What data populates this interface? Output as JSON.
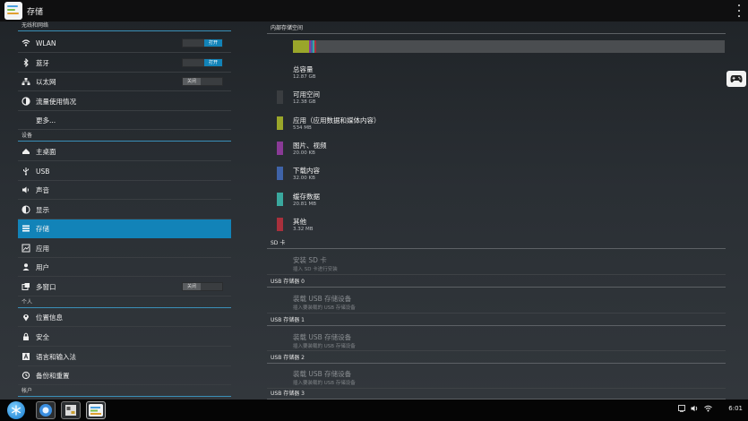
{
  "window": {
    "title": "存储"
  },
  "left": {
    "sections": [
      {
        "header": "无线和网络",
        "rows": [
          {
            "label": "WLAN",
            "icon": "wifi-icon",
            "toggle": "打开",
            "toggle_state": "on"
          },
          {
            "label": "蓝牙",
            "icon": "bluetooth-icon",
            "toggle": "打开",
            "toggle_state": "on"
          },
          {
            "label": "以太网",
            "icon": "ethernet-icon",
            "toggle": "关闭",
            "toggle_state": "off"
          },
          {
            "label": "流量使用情况",
            "icon": "data-usage-icon"
          },
          {
            "label": "更多...",
            "icon": ""
          }
        ]
      },
      {
        "header": "设备",
        "rows": [
          {
            "label": "主桌面",
            "icon": "home-icon"
          },
          {
            "label": "USB",
            "icon": "usb-icon"
          },
          {
            "label": "声音",
            "icon": "volume-icon"
          },
          {
            "label": "显示",
            "icon": "display-icon"
          },
          {
            "label": "存储",
            "icon": "storage-icon",
            "selected": true
          },
          {
            "label": "应用",
            "icon": "apps-icon"
          },
          {
            "label": "用户",
            "icon": "user-icon"
          },
          {
            "label": "多窗口",
            "icon": "multiwindow-icon",
            "toggle": "关闭",
            "toggle_state": "off"
          }
        ]
      },
      {
        "header": "个人",
        "rows": [
          {
            "label": "位置信息",
            "icon": "location-icon"
          },
          {
            "label": "安全",
            "icon": "lock-icon"
          },
          {
            "label": "语言和输入法",
            "icon": "language-icon"
          },
          {
            "label": "备份和重置",
            "icon": "backup-icon"
          }
        ]
      },
      {
        "header": "帐户",
        "rows": []
      }
    ]
  },
  "right": {
    "internal_header": "内部存储空间",
    "usage_colors": [
      "#9aa62a",
      "#7a3a8a",
      "#3a6ab0",
      "#3ab0a0",
      "#b02a3a"
    ],
    "items": [
      {
        "title": "总容量",
        "sub": "12.87 GB"
      },
      {
        "title": "可用空间",
        "sub": "12.38 GB",
        "color": "#3a3d40"
      },
      {
        "title": "应用（应用数据和媒体内容）",
        "sub": "534 MB",
        "color": "#9aa62a"
      },
      {
        "title": "图片、视频",
        "sub": "20.00 KB",
        "color": "#8a3a96"
      },
      {
        "title": "下载内容",
        "sub": "32.00 KB",
        "color": "#3f63a8"
      },
      {
        "title": "缓存数据",
        "sub": "20.81 MB",
        "color": "#3aa89e"
      },
      {
        "title": "其他",
        "sub": "3.32 MB",
        "color": "#a8303c"
      }
    ],
    "sd": {
      "header": "SD 卡",
      "title": "安装 SD 卡",
      "sub": "插入 SD 卡进行安装"
    },
    "usb": [
      {
        "header": "USB 存储器 0",
        "title": "装载 USB 存储设备",
        "sub": "插入要装载的 USB 存储设备"
      },
      {
        "header": "USB 存储器 1",
        "title": "装载 USB 存储设备",
        "sub": "插入要装载的 USB 存储设备"
      },
      {
        "header": "USB 存储器 2",
        "title": "装载 USB 存储设备",
        "sub": "插入要装载的 USB 存储设备"
      },
      {
        "header": "USB 存储器 3"
      }
    ]
  },
  "taskbar": {
    "clock": "6:01"
  }
}
